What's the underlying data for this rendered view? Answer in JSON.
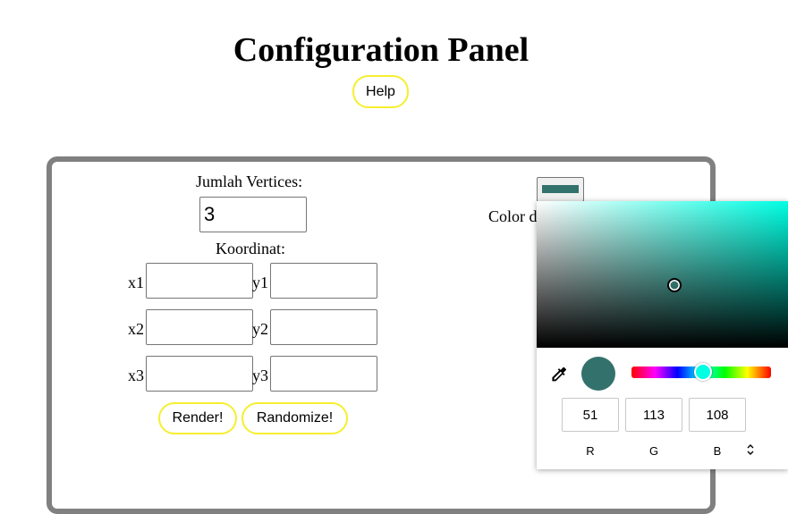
{
  "header": {
    "title": "Configuration Panel",
    "help_label": "Help"
  },
  "form": {
    "vertex_count_label": "Jumlah Vertices:",
    "vertex_count_value": "3",
    "coords_label": "Koordinat:",
    "rows": [
      {
        "x_label": "x1",
        "y_label": "y1",
        "x_value": "",
        "y_value": ""
      },
      {
        "x_label": "x2",
        "y_label": "y2",
        "x_value": "",
        "y_value": ""
      },
      {
        "x_label": "x3",
        "y_label": "y3",
        "x_value": "",
        "y_value": ""
      }
    ],
    "render_label": "Render!",
    "randomize_label": "Randomize!",
    "color_label": "Color d"
  },
  "color_picker": {
    "selected_color": "#33716c",
    "hue_color": "#00ffe3",
    "r": "51",
    "g": "113",
    "b": "108",
    "r_label": "R",
    "g_label": "G",
    "b_label": "B",
    "icons": [
      "eyedropper-icon",
      "mode-toggle-icon"
    ]
  },
  "colors": {
    "button_border": "#f5ef2e",
    "panel_border": "#808080"
  }
}
